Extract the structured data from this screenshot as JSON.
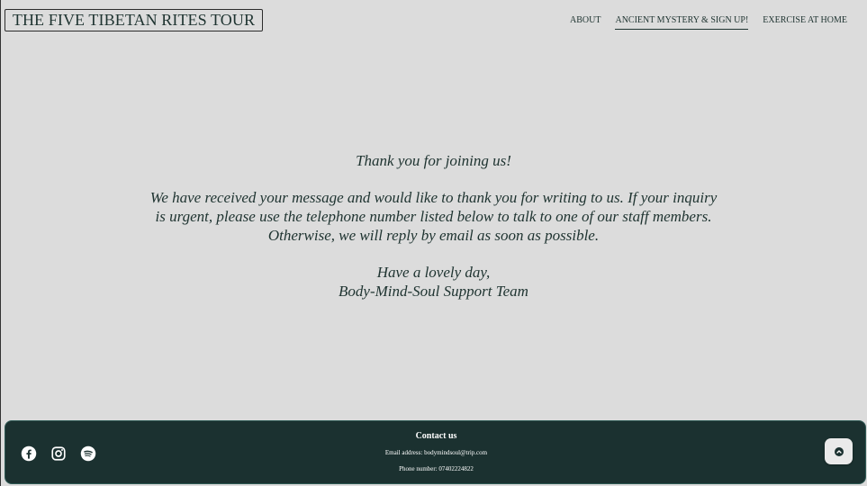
{
  "header": {
    "site_title": "THE FIVE TIBETAN RITES TOUR",
    "nav": [
      {
        "label": "ABOUT",
        "active": false
      },
      {
        "label": "ANCIENT MYSTERY & SIGN UP!",
        "active": true
      },
      {
        "label": "EXERCISE AT HOME",
        "active": false
      }
    ]
  },
  "message": {
    "heading": "Thank you for joining us!",
    "body": "We have received your message and would like to thank you for writing to us. If your inquiry is urgent, please use the telephone number listed below to talk to one of our staff members. Otherwise, we will reply by email as soon as possible.",
    "closing": "Have a lovely day,",
    "signature": "Body-Mind-Soul Support Team"
  },
  "footer": {
    "contact_title": "Contact us",
    "email_label": "Email address:",
    "email_value": "bodymindsoul@trip.com",
    "phone_label": "Phone number:",
    "phone_value": "07402224822",
    "social_icons": [
      "facebook-icon",
      "instagram-icon",
      "spotify-icon"
    ],
    "scroll_top_icon": "arrow-up-icon"
  },
  "colors": {
    "background": "#dcdcdc",
    "text": "#1e3330",
    "footer_bg": "#1b3130",
    "footer_text": "#ffffff",
    "scroll_button_bg": "#eaeaea"
  }
}
